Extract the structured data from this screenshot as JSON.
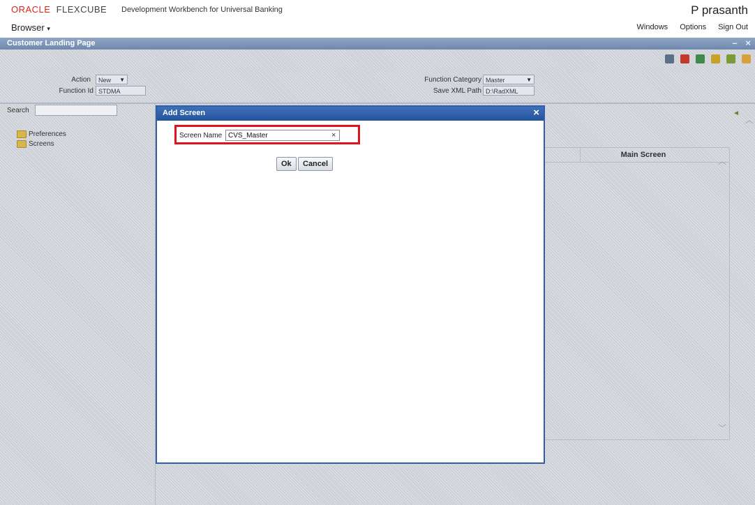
{
  "header": {
    "logo_oracle": "ORACLE",
    "logo_product": "FLEXCUBE",
    "workbench_title": "Development Workbench for Universal Banking",
    "user_name": "P prasanth",
    "browser_menu": "Browser",
    "menu_windows": "Windows",
    "menu_options": "Options",
    "menu_signout": "Sign Out"
  },
  "window": {
    "title": "Customer Landing Page",
    "minimize": "–",
    "close": "×"
  },
  "toolbar": {
    "icons": [
      "save-icon",
      "delete-icon",
      "list-icon",
      "generate-icon",
      "deploy-icon",
      "exit-icon"
    ]
  },
  "form": {
    "action_label": "Action",
    "action_value": "New",
    "function_id_label": "Function Id",
    "function_id_value": "STDMA",
    "function_category_label": "Function Category",
    "function_category_value": "Master",
    "save_xml_path_label": "Save XML Path",
    "save_xml_path_value": "D:\\RadXML"
  },
  "left_panel": {
    "search_label": "Search",
    "tree_items": [
      "Preferences",
      "Screens"
    ]
  },
  "grid": {
    "main_screen_header": "Main Screen"
  },
  "dialog": {
    "title": "Add Screen",
    "screen_name_label": "Screen Name",
    "screen_name_value": "CVS_Master",
    "ok_label": "Ok",
    "cancel_label": "Cancel",
    "close_glyph": "×",
    "clear_glyph": "×"
  },
  "colors": {
    "oracle_red": "#d9251c",
    "dialog_title_blue": "#22549c",
    "highlight_red": "#e0141e",
    "window_title": "#6f88ad"
  }
}
